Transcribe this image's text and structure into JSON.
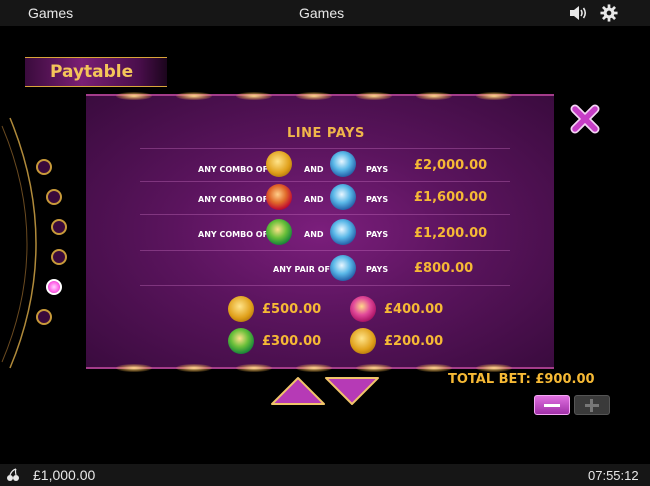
{
  "topbar": {
    "left_label": "Games",
    "title": "Games"
  },
  "paytable": {
    "tab_label": "Paytable",
    "section_title": "LINE PAYS",
    "rows": [
      {
        "prefix": "ANY COMBO OF",
        "joiner": "AND",
        "suffix": "PAYS",
        "amount": "£2,000.00"
      },
      {
        "prefix": "ANY COMBO OF",
        "joiner": "AND",
        "suffix": "PAYS",
        "amount": "£1,600.00"
      },
      {
        "prefix": "ANY COMBO OF",
        "joiner": "AND",
        "suffix": "PAYS",
        "amount": "£1,200.00"
      },
      {
        "prefix": "ANY PAIR OF",
        "suffix": "PAYS",
        "amount": "£800.00"
      }
    ],
    "singles": [
      {
        "amount": "£500.00"
      },
      {
        "amount": "£400.00"
      },
      {
        "amount": "£300.00"
      },
      {
        "amount": "£200.00"
      }
    ]
  },
  "pager": {
    "total_pages": 6,
    "active_page": 5
  },
  "bet": {
    "total_bet_label": "TOTAL BET: £900.00"
  },
  "footer": {
    "balance": "£1,000.00",
    "time": "07:55:12"
  }
}
